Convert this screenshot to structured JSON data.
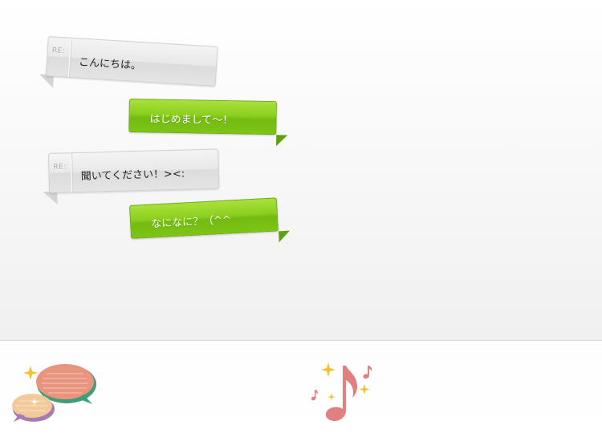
{
  "messages": [
    {
      "side": "received",
      "prefix": "RE:",
      "text": "こんにちは。"
    },
    {
      "side": "sent",
      "text": "はじめまして～！"
    },
    {
      "side": "received",
      "prefix": "RE:",
      "text": "聞いてください！><:"
    },
    {
      "side": "sent",
      "text": "なになに？（^^"
    }
  ],
  "colors": {
    "sent_bubble": "#8ccf1f",
    "received_bubble": "#e6e6e6",
    "chat_icon_back": "#e8947f",
    "chat_icon_front": "#f2c99a",
    "music_note": "#e08080",
    "sparkle": "#f2c230"
  },
  "footer": {
    "icons": [
      "speech-bubbles-icon",
      "music-note-icon"
    ]
  }
}
